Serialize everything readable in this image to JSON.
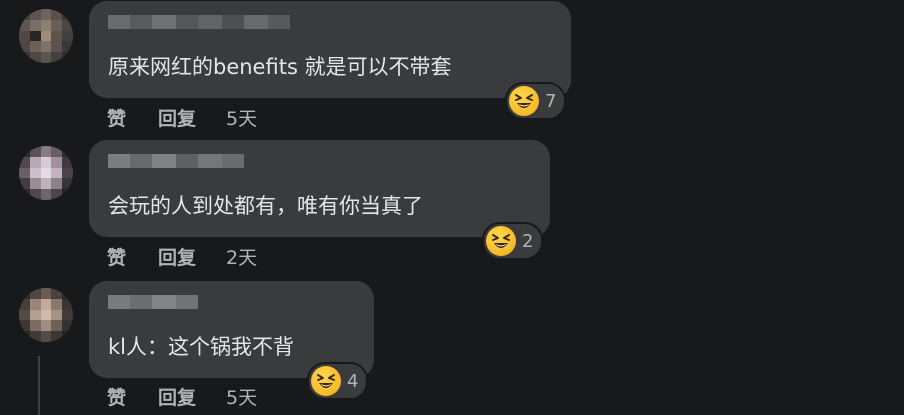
{
  "comments": [
    {
      "text": "原来网红的benefits 就是可以不带套",
      "reaction_icon": "laughing-emoji",
      "reaction_count": "7",
      "like_label": "赞",
      "reply_label": "回复",
      "time": "5天"
    },
    {
      "text": "会玩的人到处都有，唯有你当真了",
      "reaction_icon": "laughing-emoji",
      "reaction_count": "2",
      "like_label": "赞",
      "reply_label": "回复",
      "time": "2天"
    },
    {
      "text": "kl人：这个锅我不背",
      "reaction_icon": "laughing-emoji",
      "reaction_count": "4",
      "like_label": "赞",
      "reply_label": "回复",
      "time": "5天"
    }
  ],
  "colors": {
    "background": "#18191a",
    "bubble": "#3a3b3c",
    "text": "#e4e6eb",
    "secondary_text": "#b0b3b8",
    "emoji": "#f7b928"
  }
}
